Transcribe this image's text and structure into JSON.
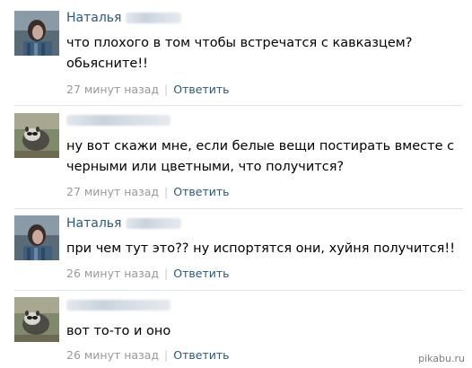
{
  "comments": [
    {
      "author": "Наталья",
      "text": "что плохого в том чтобы встречатся с кавказцем? обьясните!!",
      "time": "27 минут назад",
      "reply": "Ответить"
    },
    {
      "author": "",
      "text": "ну вот скажи мне, если белые вещи постирать вместе с черными или цветными, что получится?",
      "time": "27 минут назад",
      "reply": "Ответить"
    },
    {
      "author": "Наталья",
      "text": "при чем тут это?? ну испортятся они, хуйня получится!!",
      "time": "26 минут назад",
      "reply": "Ответить"
    },
    {
      "author": "",
      "text": "вот то-то и оно",
      "time": "26 минут назад",
      "reply": "Ответить"
    }
  ],
  "separator": "|",
  "watermark": "pikabu.ru",
  "colors": {
    "link": "#2b587a",
    "time": "#999999",
    "divider": "#dfe4ea"
  }
}
